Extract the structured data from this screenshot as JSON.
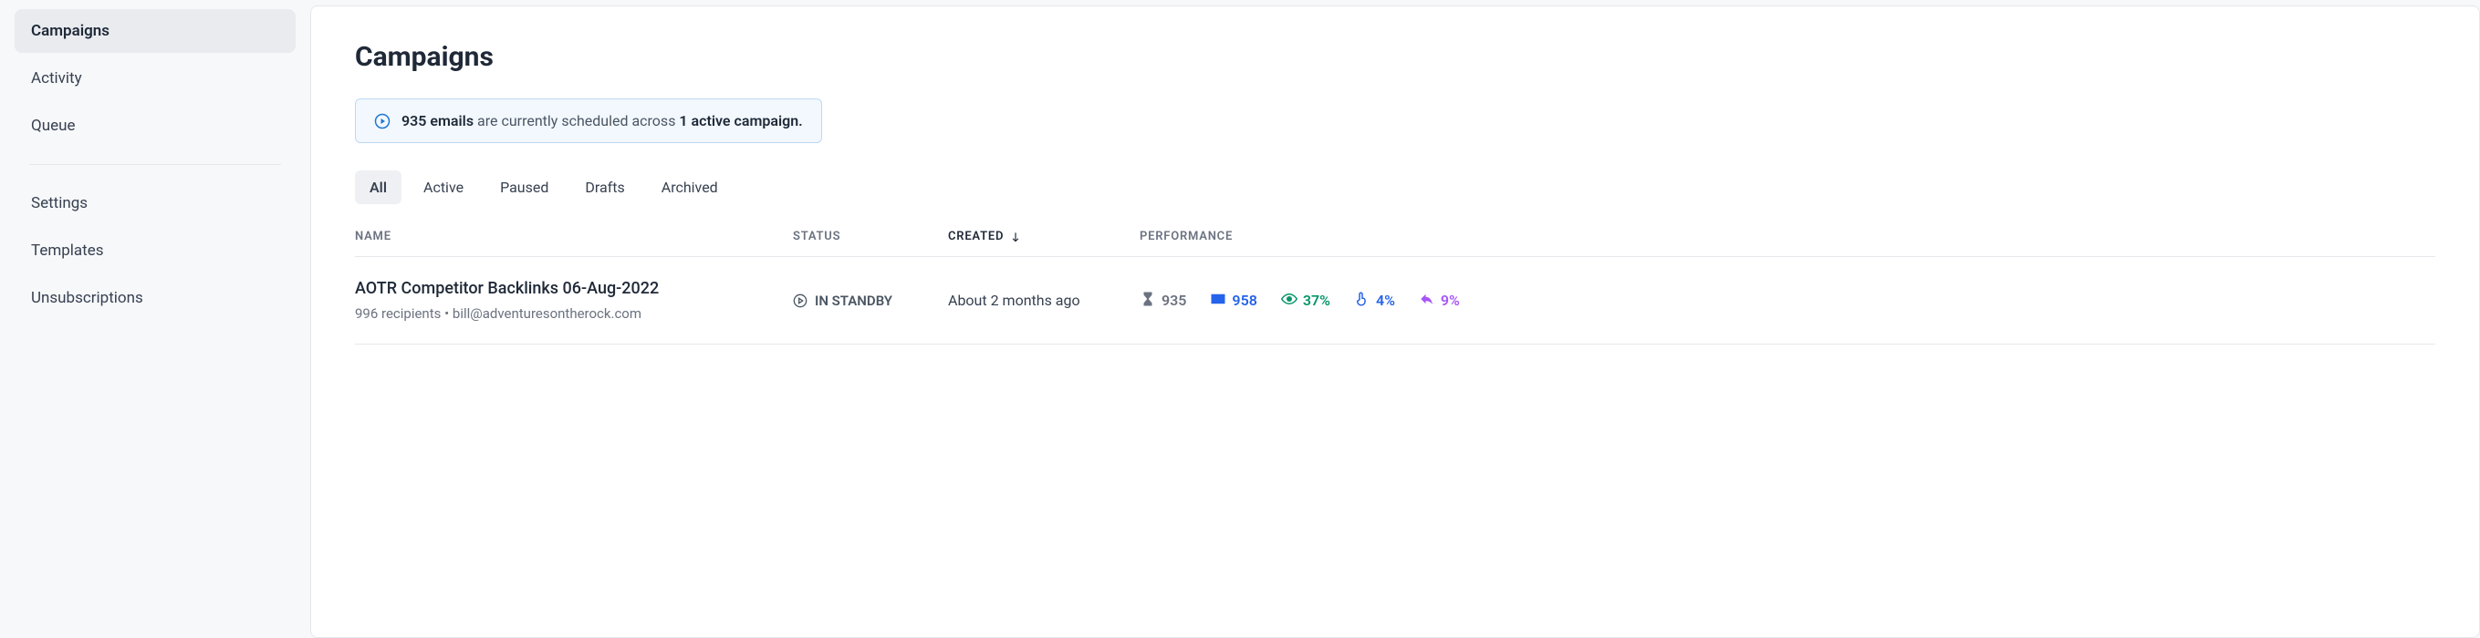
{
  "sidebar": {
    "primary": [
      {
        "label": "Campaigns",
        "active": true
      },
      {
        "label": "Activity",
        "active": false
      },
      {
        "label": "Queue",
        "active": false
      }
    ],
    "secondary": [
      {
        "label": "Settings"
      },
      {
        "label": "Templates"
      },
      {
        "label": "Unsubscriptions"
      }
    ]
  },
  "header": {
    "title": "Campaigns"
  },
  "banner": {
    "count_label": "935 emails",
    "mid_text": " are currently scheduled across ",
    "campaign_label": "1 active campaign."
  },
  "tabs": [
    {
      "label": "All",
      "active": true
    },
    {
      "label": "Active",
      "active": false
    },
    {
      "label": "Paused",
      "active": false
    },
    {
      "label": "Drafts",
      "active": false
    },
    {
      "label": "Archived",
      "active": false
    }
  ],
  "columns": {
    "name": "NAME",
    "status": "STATUS",
    "created": "CREATED",
    "performance": "PERFORMANCE"
  },
  "rows": [
    {
      "name": "AOTR Competitor Backlinks 06-Aug-2022",
      "recipients": "996 recipients",
      "email": "bill@adventuresontherock.com",
      "status": "IN STANDBY",
      "created": "About 2 months ago",
      "perf": {
        "queued": "935",
        "sent": "958",
        "open_rate": "37%",
        "click_rate": "4%",
        "reply_rate": "9%"
      }
    }
  ]
}
